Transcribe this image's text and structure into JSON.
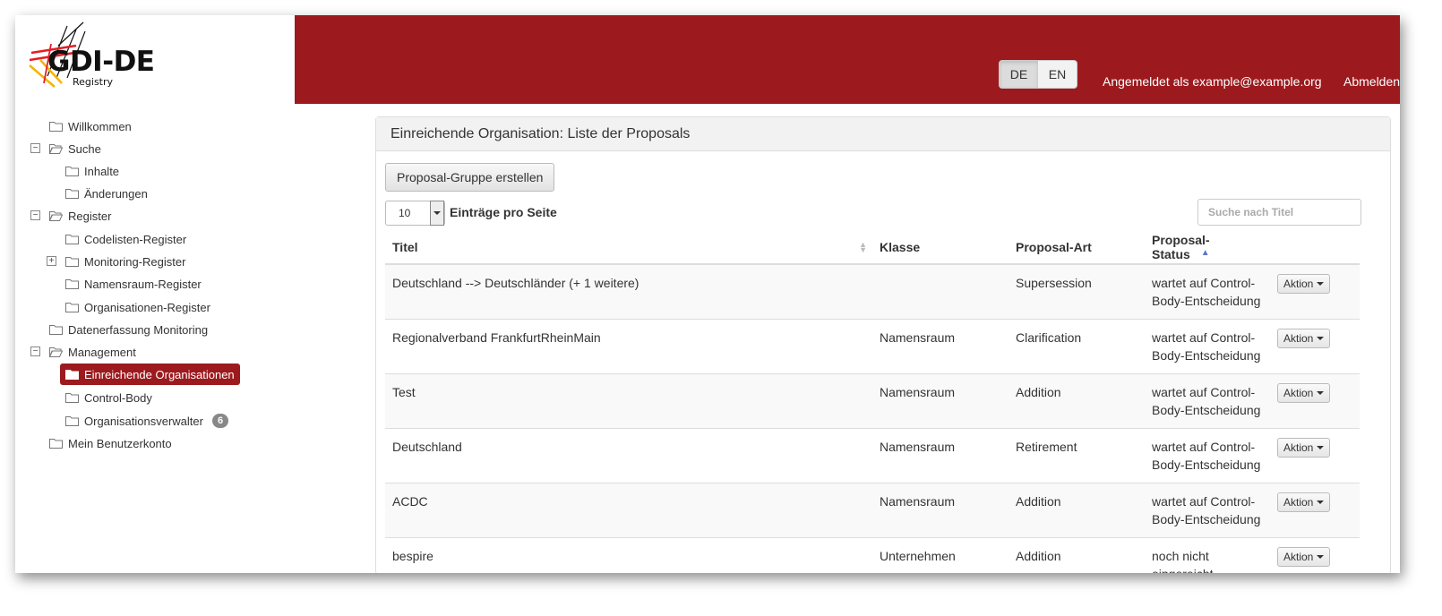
{
  "header": {
    "logo_text": "GDI-DE",
    "logo_sub": "Registry",
    "lang": [
      "DE",
      "EN"
    ],
    "login_text": "Angemeldet als example@example.org",
    "logout_label": "Abmelden"
  },
  "colors": {
    "brand_red": "#9c1a1e",
    "sort_active": "#5a76c8"
  },
  "sidebar": {
    "items": [
      {
        "label": "Willkommen"
      },
      {
        "label": "Suche"
      },
      {
        "label": "Inhalte"
      },
      {
        "label": "Änderungen"
      },
      {
        "label": "Register"
      },
      {
        "label": "Codelisten-Register"
      },
      {
        "label": "Monitoring-Register"
      },
      {
        "label": "Namensraum-Register"
      },
      {
        "label": "Organisationen-Register"
      },
      {
        "label": "Datenerfassung Monitoring"
      },
      {
        "label": "Management"
      },
      {
        "label": "Einreichende Organisationen"
      },
      {
        "label": "Control-Body"
      },
      {
        "label": "Organisationsverwalter",
        "badge": "6"
      },
      {
        "label": "Mein Benutzerkonto"
      }
    ]
  },
  "main": {
    "panel_title": "Einreichende Organisation: Liste der Proposals",
    "create_button": "Proposal-Gruppe erstellen",
    "page_size": "10",
    "page_size_label": "Einträge pro Seite",
    "search_placeholder": "Suche nach Titel",
    "columns": [
      "Titel",
      "Klasse",
      "Proposal-Art",
      "Proposal-Status"
    ],
    "action_label": "Aktion",
    "rows": [
      {
        "title": "Deutschland --> Deutschländer (+ 1 weitere)",
        "klasse": "",
        "art": "Supersession",
        "status": "wartet auf Control-Body-Entscheidung"
      },
      {
        "title": "Regionalverband FrankfurtRheinMain",
        "klasse": "Namensraum",
        "art": "Clarification",
        "status": "wartet auf Control-Body-Entscheidung"
      },
      {
        "title": "Test",
        "klasse": "Namensraum",
        "art": "Addition",
        "status": "wartet auf Control-Body-Entscheidung"
      },
      {
        "title": "Deutschland",
        "klasse": "Namensraum",
        "art": "Retirement",
        "status": "wartet auf Control-Body-Entscheidung"
      },
      {
        "title": "ACDC",
        "klasse": "Namensraum",
        "art": "Addition",
        "status": "wartet auf Control-Body-Entscheidung"
      },
      {
        "title": "bespire",
        "klasse": "Unternehmen",
        "art": "Addition",
        "status": "noch nicht eingereicht"
      }
    ]
  }
}
